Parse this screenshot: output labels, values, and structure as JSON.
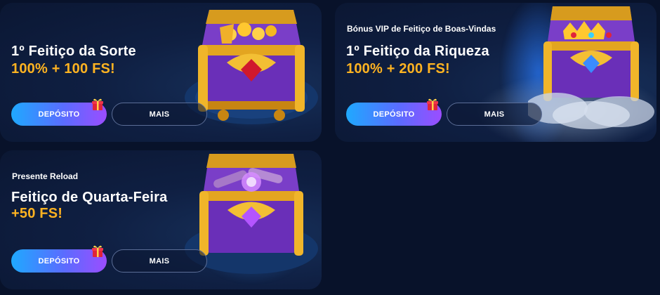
{
  "cards": [
    {
      "subtitle": "",
      "title": "1º Feitiço da Sorte",
      "offer": "100% + 100 FS!",
      "deposit_label": "DEPÓSITO",
      "more_label": "MAIS"
    },
    {
      "subtitle": "Bónus VIP de Feitiço de Boas-Vindas",
      "title": "1º Feitiço da Riqueza",
      "offer": "100% + 200 FS!",
      "deposit_label": "DEPÓSITO",
      "more_label": "MAIS"
    },
    {
      "subtitle": "Presente Reload",
      "title": "Feitiço de Quarta-Feira",
      "offer": "+50 FS!",
      "deposit_label": "DEPÓSITO",
      "more_label": "MAIS"
    }
  ],
  "colors": {
    "offer": "#ffb321",
    "card_bg": "#0f1f42",
    "page_bg": "#08122a",
    "button_gradient_start": "#1fa9ff",
    "button_gradient_end": "#9b4dff"
  },
  "icons": [
    "gift-icon",
    "treasure-chest-illustration"
  ]
}
